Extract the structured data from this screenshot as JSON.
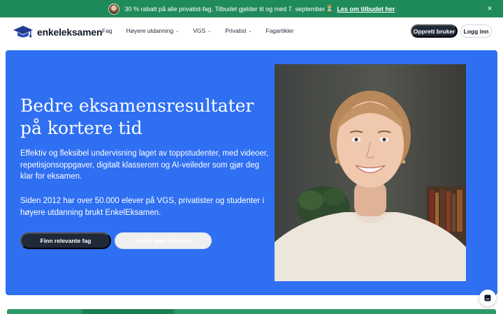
{
  "promo": {
    "text": "30 % rabatt på alle privatist-fag. Tilbudet gjelder til og med 7. september",
    "glyph": "⏳",
    "link": "Les om tilbudet her",
    "close": "×"
  },
  "nav": {
    "logo_text": "enkeleksamen",
    "links": [
      "Fag",
      "Høyere utdanning",
      "VGS",
      "Privatist",
      "Fagartikler"
    ],
    "chevron": "⌄",
    "signup": "Opprett bruker",
    "login": "Logg inn"
  },
  "hero": {
    "title": "Bedre eksamensresultater på kortere tid",
    "paragraph1": "Effektiv og fleksibel undervisning laget av toppstudenter, med videoer, repetisjonsoppgaver, digitalt klasserom og AI-veileder som gjør deg klar for eksamen.",
    "paragraph2": "Siden 2012 har over 50.000 elever på VGS, privatister og studenter i høyere utdanning brukt EnkelEksamen.",
    "cta_primary": "Finn relevante fag",
    "cta_secondary": "Snakk med rådgiver"
  },
  "colors": {
    "promo_bg": "#1f8a5a",
    "hero_bg": "#2f6ff2",
    "dark_button": "#1f2937"
  },
  "icons": {
    "logo": "graduation-cap-icon",
    "close": "close-icon",
    "chat": "chat-icon"
  }
}
